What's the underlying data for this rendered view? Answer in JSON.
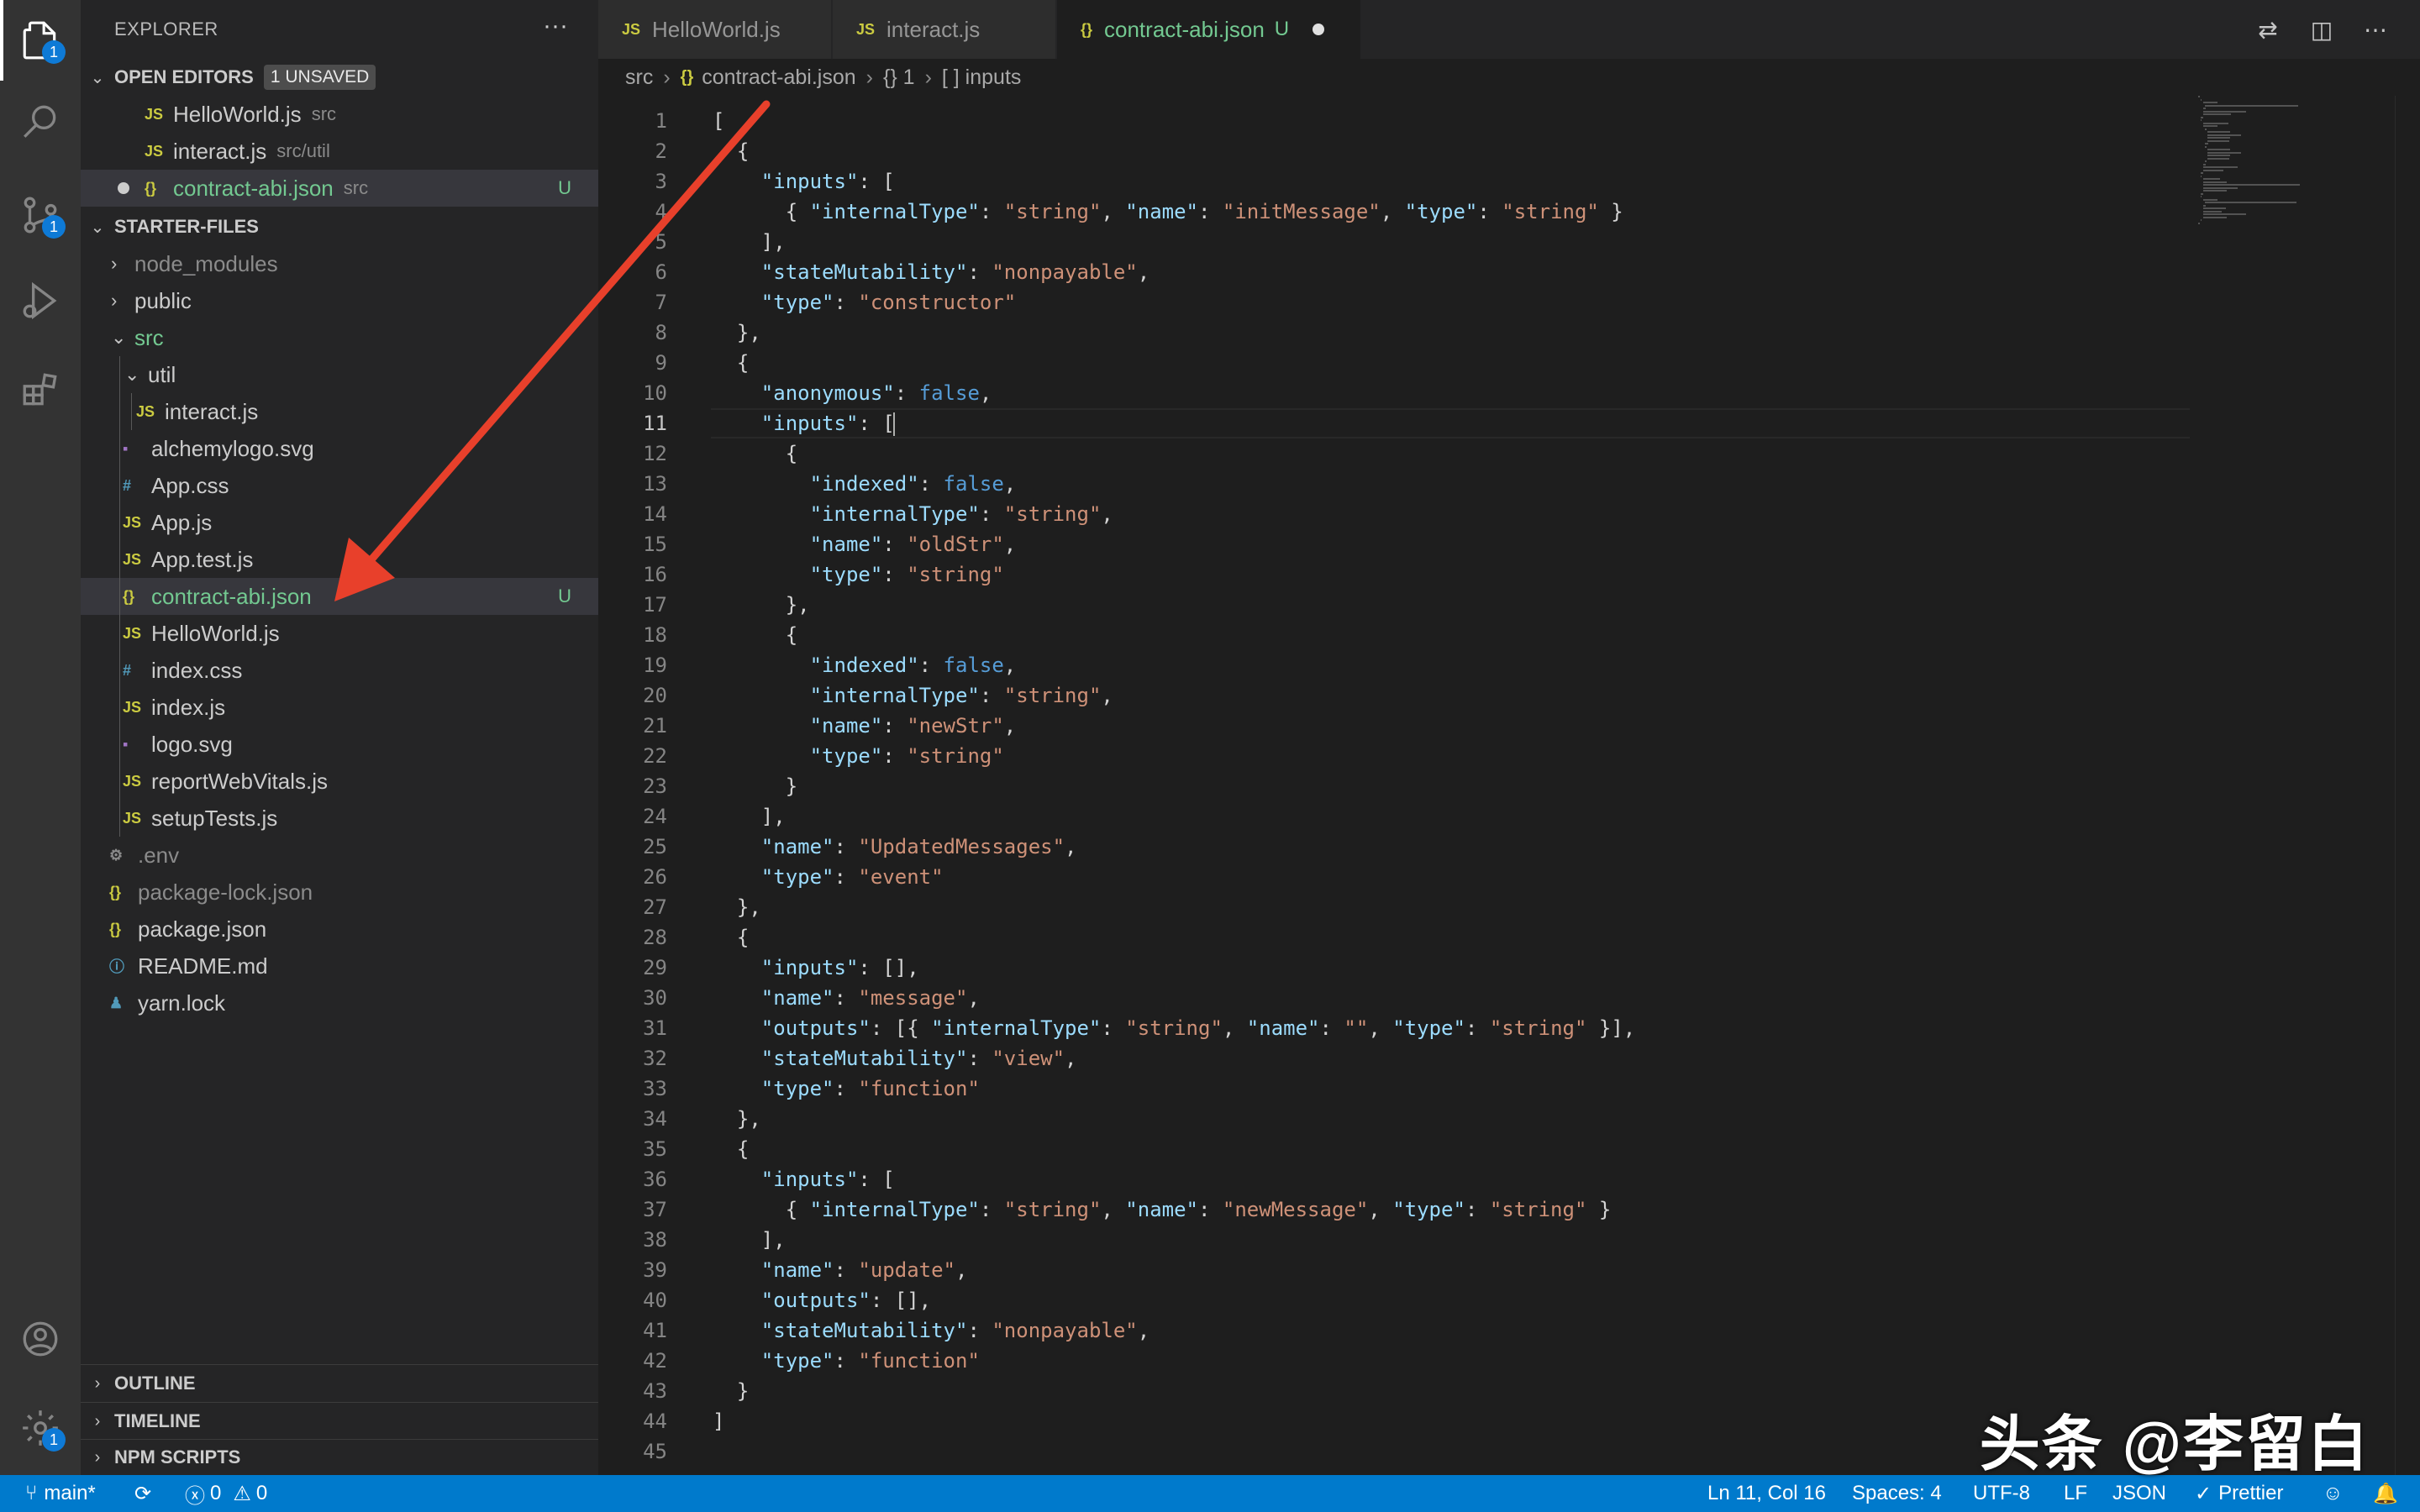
{
  "explorer": {
    "title": "EXPLORER",
    "more": "···",
    "open_editors": {
      "label": "OPEN EDITORS",
      "badge": "1 UNSAVED",
      "items": [
        {
          "icon": "JS",
          "name": "HelloWorld.js",
          "desc": "src"
        },
        {
          "icon": "JS",
          "name": "interact.js",
          "desc": "src/util"
        },
        {
          "icon": "{}",
          "name": "contract-abi.json",
          "desc": "src",
          "status": "U"
        }
      ]
    },
    "project": {
      "label": "STARTER-FILES",
      "tree": [
        {
          "name": "node_modules"
        },
        {
          "name": "public"
        },
        {
          "name": "src"
        },
        {
          "name": "util"
        },
        {
          "icon": "JS",
          "name": "interact.js"
        },
        {
          "name": "alchemylogo.svg"
        },
        {
          "icon": "#",
          "name": "App.css"
        },
        {
          "icon": "JS",
          "name": "App.js"
        },
        {
          "icon": "JS",
          "name": "App.test.js"
        },
        {
          "icon": "{}",
          "name": "contract-abi.json",
          "status": "U"
        },
        {
          "icon": "JS",
          "name": "HelloWorld.js"
        },
        {
          "icon": "#",
          "name": "index.css"
        },
        {
          "icon": "JS",
          "name": "index.js"
        },
        {
          "name": "logo.svg"
        },
        {
          "icon": "JS",
          "name": "reportWebVitals.js"
        },
        {
          "icon": "JS",
          "name": "setupTests.js"
        },
        {
          "name": ".env"
        },
        {
          "icon": "{}",
          "name": "package-lock.json"
        },
        {
          "icon": "{}",
          "name": "package.json"
        },
        {
          "name": "README.md"
        },
        {
          "name": "yarn.lock"
        }
      ]
    },
    "bottom_sections": [
      "OUTLINE",
      "TIMELINE",
      "NPM SCRIPTS"
    ]
  },
  "activity_badges": {
    "explorer": "1",
    "scm": "1",
    "settings": "1"
  },
  "tabs": [
    {
      "icon": "JS",
      "label": "HelloWorld.js"
    },
    {
      "icon": "JS",
      "label": "interact.js"
    },
    {
      "icon": "{}",
      "label": "contract-abi.json",
      "status": "U"
    }
  ],
  "breadcrumb": {
    "folder": "src",
    "icon": "{}",
    "file": "contract-abi.json",
    "item1": "{} 1",
    "item2": "[ ] inputs"
  },
  "editor": {
    "current_line": 11,
    "lines": [
      "[",
      "  {",
      "    \"inputs\": [",
      "      { \"internalType\": \"string\", \"name\": \"initMessage\", \"type\": \"string\" }",
      "    ],",
      "    \"stateMutability\": \"nonpayable\",",
      "    \"type\": \"constructor\"",
      "  },",
      "  {",
      "    \"anonymous\": false,",
      "    \"inputs\": [",
      "      {",
      "        \"indexed\": false,",
      "        \"internalType\": \"string\",",
      "        \"name\": \"oldStr\",",
      "        \"type\": \"string\"",
      "      },",
      "      {",
      "        \"indexed\": false,",
      "        \"internalType\": \"string\",",
      "        \"name\": \"newStr\",",
      "        \"type\": \"string\"",
      "      }",
      "    ],",
      "    \"name\": \"UpdatedMessages\",",
      "    \"type\": \"event\"",
      "  },",
      "  {",
      "    \"inputs\": [],",
      "    \"name\": \"message\",",
      "    \"outputs\": [{ \"internalType\": \"string\", \"name\": \"\", \"type\": \"string\" }],",
      "    \"stateMutability\": \"view\",",
      "    \"type\": \"function\"",
      "  },",
      "  {",
      "    \"inputs\": [",
      "      { \"internalType\": \"string\", \"name\": \"newMessage\", \"type\": \"string\" }",
      "    ],",
      "    \"name\": \"update\",",
      "    \"outputs\": [],",
      "    \"stateMutability\": \"nonpayable\",",
      "    \"type\": \"function\"",
      "  }",
      "]",
      ""
    ]
  },
  "statusbar": {
    "branch": "main*",
    "errors": "0",
    "warnings": "0",
    "position": "Ln 11, Col 16",
    "spaces": "Spaces: 4",
    "encoding": "UTF-8",
    "eol": "LF",
    "language": "JSON",
    "formatter": "Prettier"
  },
  "watermark": "头条 @李留白",
  "colors": {
    "accent": "#007acc",
    "git_untracked": "#73c991",
    "annotation_arrow": "#e8402b"
  }
}
